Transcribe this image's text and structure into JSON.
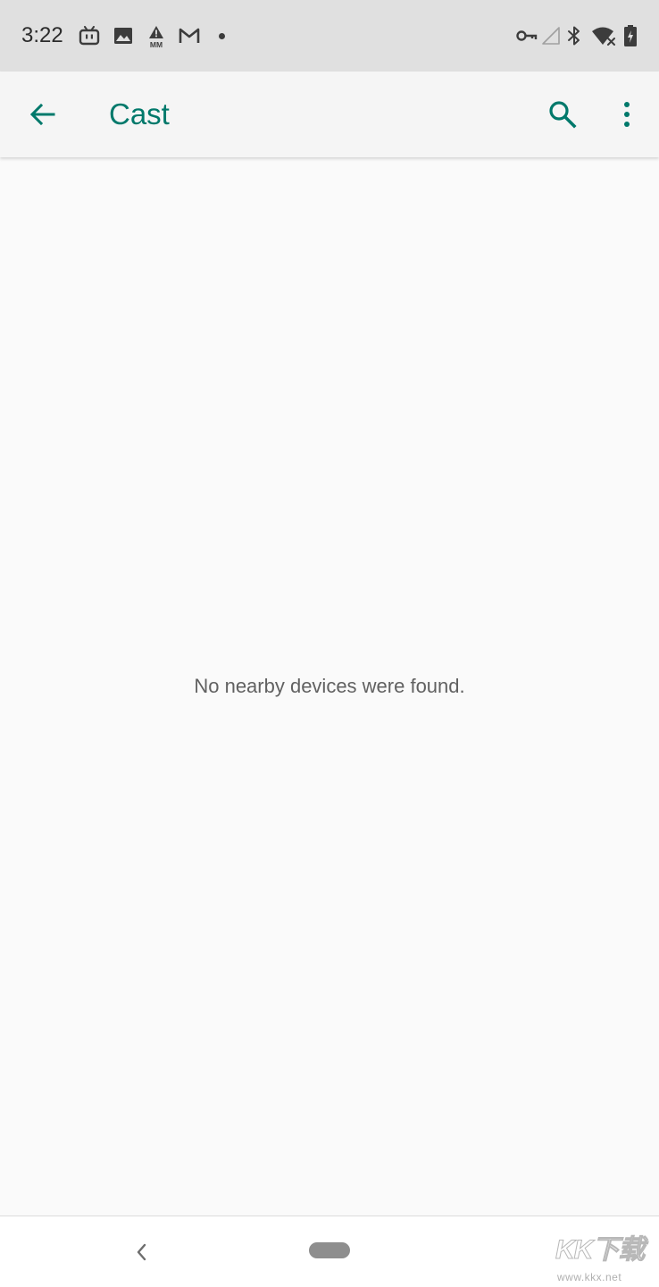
{
  "status_bar": {
    "time": "3:22",
    "notification_icons": [
      "bilibili-icon",
      "image-icon",
      "warning-mm-icon",
      "gmail-icon",
      "dot-icon"
    ],
    "system_icons": [
      "vpn-key-icon",
      "cell-signal-icon",
      "bluetooth-icon",
      "wifi-off-icon",
      "battery-charging-icon"
    ]
  },
  "app_bar": {
    "back_icon": "arrow-back-icon",
    "title": "Cast",
    "search_icon": "search-icon",
    "more_icon": "more-vert-icon"
  },
  "content": {
    "empty_message": "No nearby devices were found."
  },
  "nav_bar": {
    "back_icon": "chevron-left-icon",
    "home_icon": "home-pill-icon"
  },
  "watermark": {
    "logo": "KK下载",
    "url": "www.kkx.net"
  },
  "colors": {
    "accent": "#00796b",
    "status_bar_bg": "#e0e0e0",
    "app_bar_bg": "#f5f5f5",
    "content_bg": "#fafafa",
    "text_secondary": "#616161"
  }
}
